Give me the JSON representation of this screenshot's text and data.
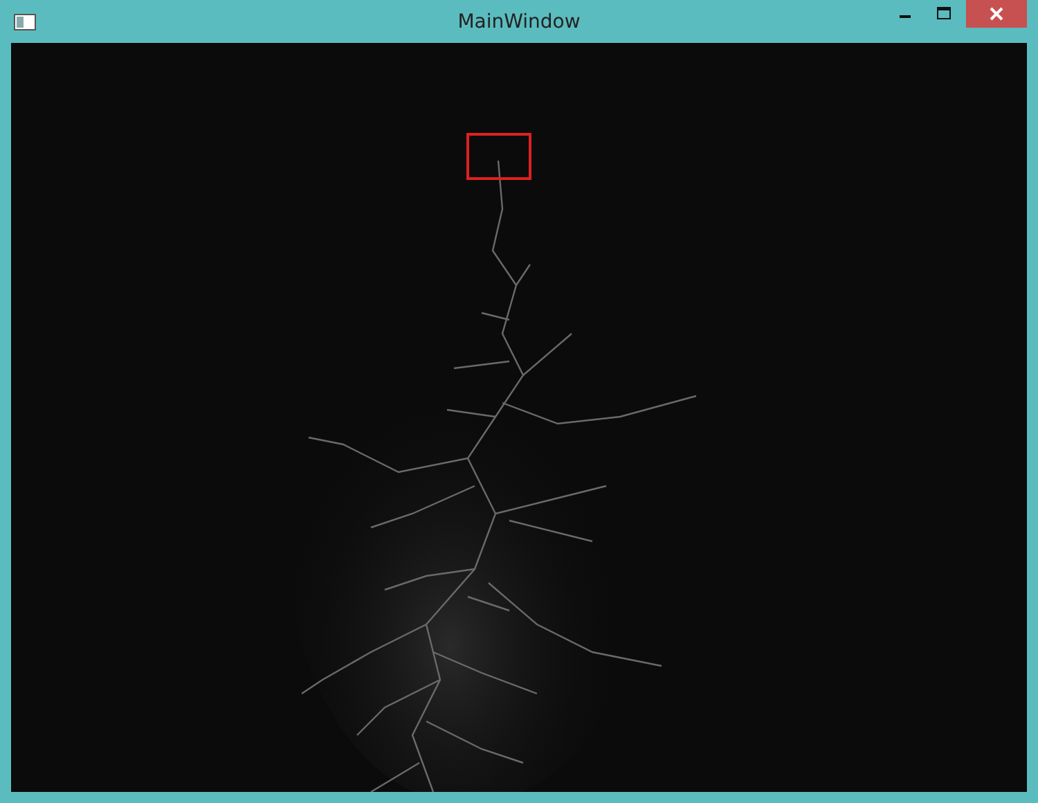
{
  "window": {
    "title": "MainWindow"
  }
}
